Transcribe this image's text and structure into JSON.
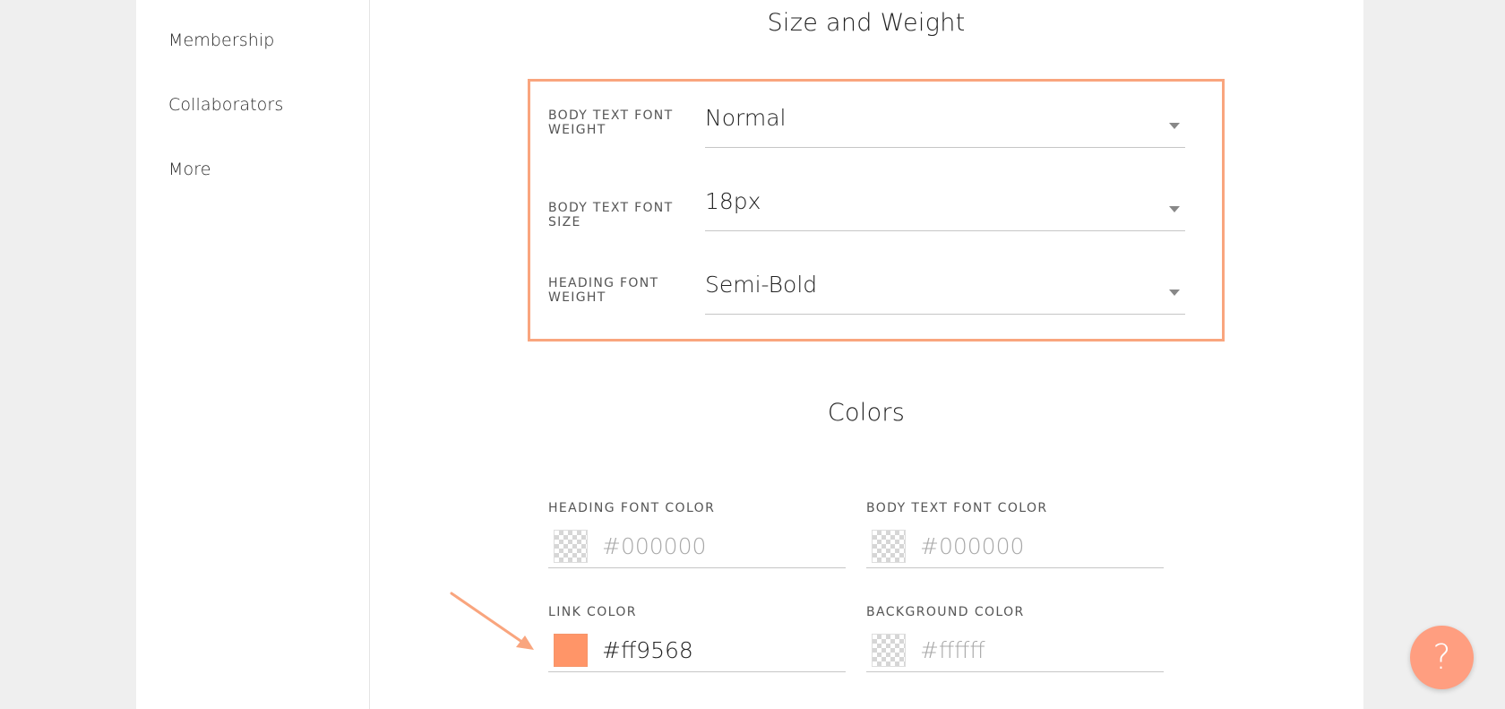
{
  "sidebar": {
    "items": [
      {
        "label": "Membership"
      },
      {
        "label": "Collaborators"
      },
      {
        "label": "More"
      }
    ]
  },
  "size_weight": {
    "title": "Size and Weight",
    "fields": [
      {
        "label_line1": "BODY TEXT FONT",
        "label_line2": "WEIGHT",
        "value": "Normal"
      },
      {
        "label_line1": "BODY TEXT FONT",
        "label_line2": "SIZE",
        "value": "18px"
      },
      {
        "label_line1": "HEADING FONT",
        "label_line2": "WEIGHT",
        "value": "Semi-Bold"
      }
    ]
  },
  "colors": {
    "title": "Colors",
    "fields": [
      {
        "label": "HEADING FONT COLOR",
        "value": "",
        "placeholder": "#000000"
      },
      {
        "label": "BODY TEXT FONT COLOR",
        "value": "",
        "placeholder": "#000000"
      },
      {
        "label": "LINK COLOR",
        "value": "#ff9568",
        "placeholder": "",
        "swatch_color": "#ff9568"
      },
      {
        "label": "BACKGROUND COLOR",
        "value": "",
        "placeholder": "#ffffff"
      }
    ]
  },
  "help": {
    "icon": "question-icon",
    "glyph": "?"
  },
  "theme": {
    "accent": "#ff9568",
    "highlight_border": "#f9a57e"
  }
}
